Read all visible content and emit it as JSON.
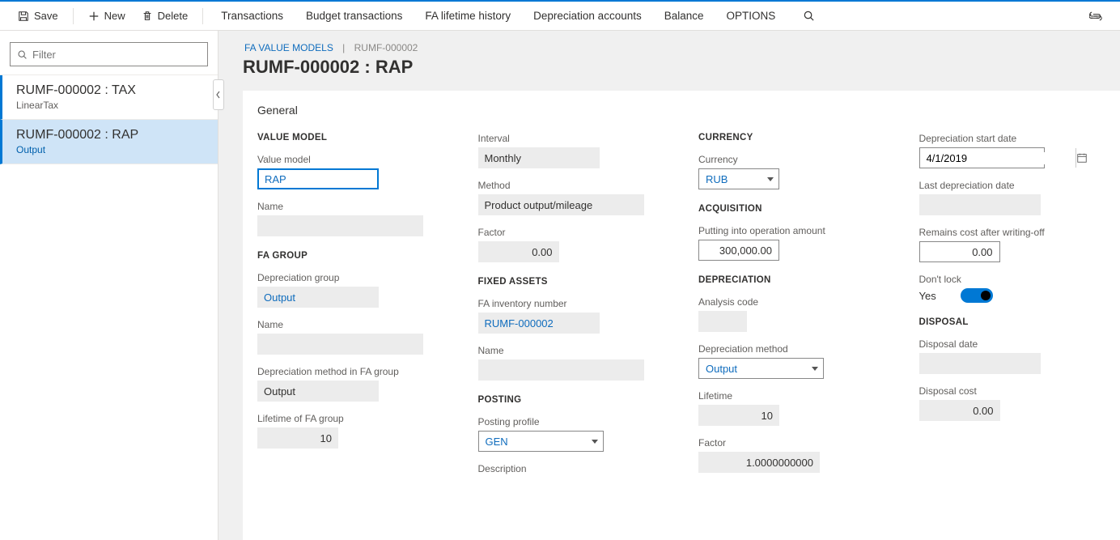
{
  "toolbar": {
    "save": "Save",
    "new": "New",
    "delete": "Delete",
    "transactions": "Transactions",
    "budget_transactions": "Budget transactions",
    "fa_lifetime_history": "FA lifetime history",
    "depreciation_accounts": "Depreciation accounts",
    "balance": "Balance",
    "options": "OPTIONS"
  },
  "filter": {
    "placeholder": "Filter"
  },
  "sidebar": {
    "items": [
      {
        "title": "RUMF-000002 : TAX",
        "sub": "LinearTax"
      },
      {
        "title": "RUMF-000002 : RAP",
        "sub": "Output"
      }
    ]
  },
  "breadcrumb": {
    "root": "FA VALUE MODELS",
    "current": "RUMF-000002"
  },
  "page_title": "RUMF-000002 : RAP",
  "section": "General",
  "col1": {
    "h_value_model": "VALUE MODEL",
    "l_value_model": "Value model",
    "v_value_model": "RAP",
    "l_name": "Name",
    "v_name": "",
    "h_fa_group": "FA GROUP",
    "l_dep_group": "Depreciation group",
    "v_dep_group": "Output",
    "l_name2": "Name",
    "v_name2": "",
    "l_dep_method_group": "Depreciation method in FA group",
    "v_dep_method_group": "Output",
    "l_lifetime_group": "Lifetime of FA group",
    "v_lifetime_group": "10"
  },
  "col2": {
    "l_interval": "Interval",
    "v_interval": "Monthly",
    "l_method": "Method",
    "v_method": "Product output/mileage",
    "l_factor": "Factor",
    "v_factor": "0.00",
    "h_fixed_assets": "FIXED ASSETS",
    "l_fa_inv": "FA inventory number",
    "v_fa_inv": "RUMF-000002",
    "l_name": "Name",
    "v_name": "",
    "h_posting": "POSTING",
    "l_posting_profile": "Posting profile",
    "v_posting_profile": "GEN",
    "l_description": "Description"
  },
  "col3": {
    "h_currency": "CURRENCY",
    "l_currency": "Currency",
    "v_currency": "RUB",
    "h_acquisition": "ACQUISITION",
    "l_putting": "Putting into operation amount",
    "v_putting": "300,000.00",
    "h_depreciation": "DEPRECIATION",
    "l_analysis": "Analysis code",
    "v_analysis": "",
    "l_dep_method": "Depreciation method",
    "v_dep_method": "Output",
    "l_lifetime": "Lifetime",
    "v_lifetime": "10",
    "l_factor": "Factor",
    "v_factor": "1.0000000000"
  },
  "col4": {
    "l_dep_start": "Depreciation start date",
    "v_dep_start": "4/1/2019",
    "l_last_dep": "Last depreciation date",
    "v_last_dep": "",
    "l_remains": "Remains cost after writing-off",
    "v_remains": "0.00",
    "l_dont_lock": "Don't lock",
    "v_dont_lock": "Yes",
    "h_disposal": "DISPOSAL",
    "l_disp_date": "Disposal date",
    "v_disp_date": "",
    "l_disp_cost": "Disposal cost",
    "v_disp_cost": "0.00"
  }
}
